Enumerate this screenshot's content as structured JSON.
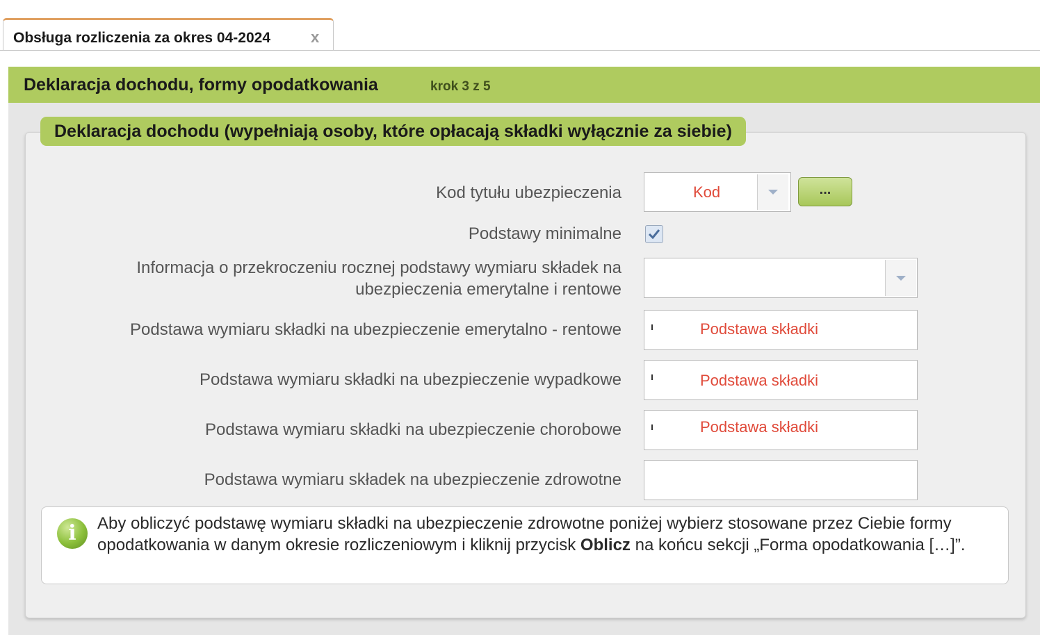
{
  "tab": {
    "title": "Obsługa rozliczenia za okres 04-2024",
    "close": "x"
  },
  "step": {
    "title": "Deklaracja dochodu, formy opodatkowania",
    "counter": "krok 3 z 5"
  },
  "section": {
    "title": "Deklaracja dochodu (wypełniają osoby, które opłacają składki wyłącznie za siebie)"
  },
  "form": {
    "kod": {
      "label": "Kod tytułu ubezpieczenia",
      "value": "Kod",
      "button": "..."
    },
    "minimalne": {
      "label": "Podstawy minimalne",
      "checked": true
    },
    "przekroczenie": {
      "label_line1": "Informacja o przekroczeniu rocznej podstawy wymiaru składek na",
      "label_line2": "ubezpieczenia emerytalne i rentowe",
      "value": ""
    },
    "emerytalno": {
      "label": "Podstawa wymiaru składki na ubezpieczenie emerytalno - rentowe",
      "value": "Podstawa składki"
    },
    "wypadkowe": {
      "label": "Podstawa wymiaru składki na ubezpieczenie wypadkowe",
      "value": "Podstawa składki"
    },
    "chorobowe": {
      "label": "Podstawa wymiaru składki na ubezpieczenie chorobowe",
      "value": "Podstawa składki"
    },
    "zdrowotne": {
      "label": "Podstawa wymiaru składek na ubezpieczenie zdrowotne",
      "value": ""
    }
  },
  "info": {
    "text_before": "Aby obliczyć podstawę wymiaru składki na ubezpieczenie zdrowotne poniżej wybierz stosowane przez Ciebie formy opodatkowania w danym okresie rozliczeniowym i kliknij przycisk ",
    "bold": "Oblicz",
    "text_after": " na końcu sekcji „Forma opodatkowania […]”."
  },
  "colors": {
    "accent_green": "#afcb5f",
    "placeholder_red": "#e04a3a",
    "tab_top": "#e0a060"
  }
}
